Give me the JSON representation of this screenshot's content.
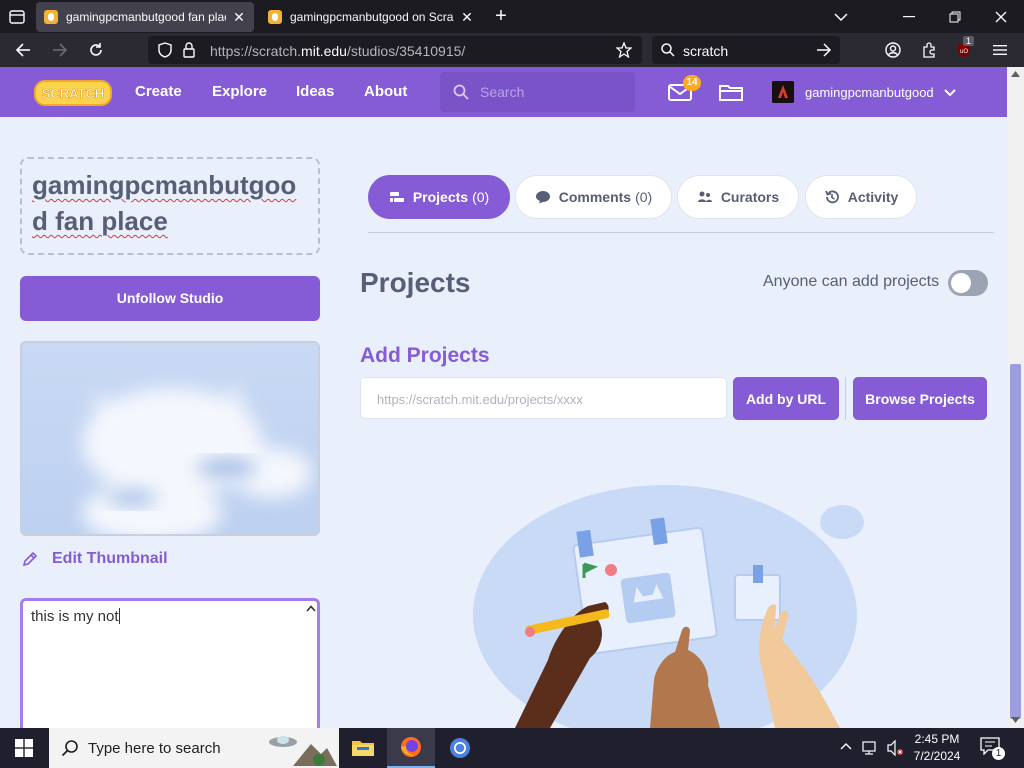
{
  "browser": {
    "tabs": [
      {
        "title": "gamingpcmanbutgood fan plac",
        "active": true
      },
      {
        "title": "gamingpcmanbutgood on Scra",
        "active": false
      }
    ],
    "url_prefix": "https://scratch.",
    "url_host": "mit.edu",
    "url_path": "/studios/35410915/",
    "search_value": "scratch",
    "extension_badge": "1"
  },
  "scratch_nav": {
    "logo_text": "SCRATCH",
    "menu": [
      "Create",
      "Explore",
      "Ideas",
      "About"
    ],
    "search_placeholder": "Search",
    "messages_count": "14",
    "username": "gamingpcmanbutgood"
  },
  "studio": {
    "title": "gamingpcmanbutgood fan place",
    "unfollow_label": "Unfollow Studio",
    "edit_thumbnail_label": "Edit Thumbnail",
    "description_value": "this is my not"
  },
  "studio_tabs": [
    {
      "label": "Projects",
      "count": "(0)",
      "icon": "projects-icon",
      "active": true
    },
    {
      "label": "Comments",
      "count": "(0)",
      "icon": "comment-icon",
      "active": false
    },
    {
      "label": "Curators",
      "count": "",
      "icon": "curators-icon",
      "active": false
    },
    {
      "label": "Activity",
      "count": "",
      "icon": "activity-icon",
      "active": false
    }
  ],
  "projects_section": {
    "heading": "Projects",
    "anyone_can_add_label": "Anyone can add projects",
    "anyone_can_add_enabled": false,
    "add_heading": "Add Projects",
    "url_placeholder": "https://scratch.mit.edu/projects/xxxx",
    "add_by_url_label": "Add by URL",
    "browse_label": "Browse Projects"
  },
  "taskbar": {
    "search_placeholder": "Type here to search",
    "time": "2:45 PM",
    "date": "7/2/2024",
    "notification_count": "1"
  },
  "colors": {
    "scratch_purple": "#855cd6",
    "page_bg": "#e9f0fc",
    "text_dark": "#575e75",
    "browser_dark": "#1c1b22"
  }
}
